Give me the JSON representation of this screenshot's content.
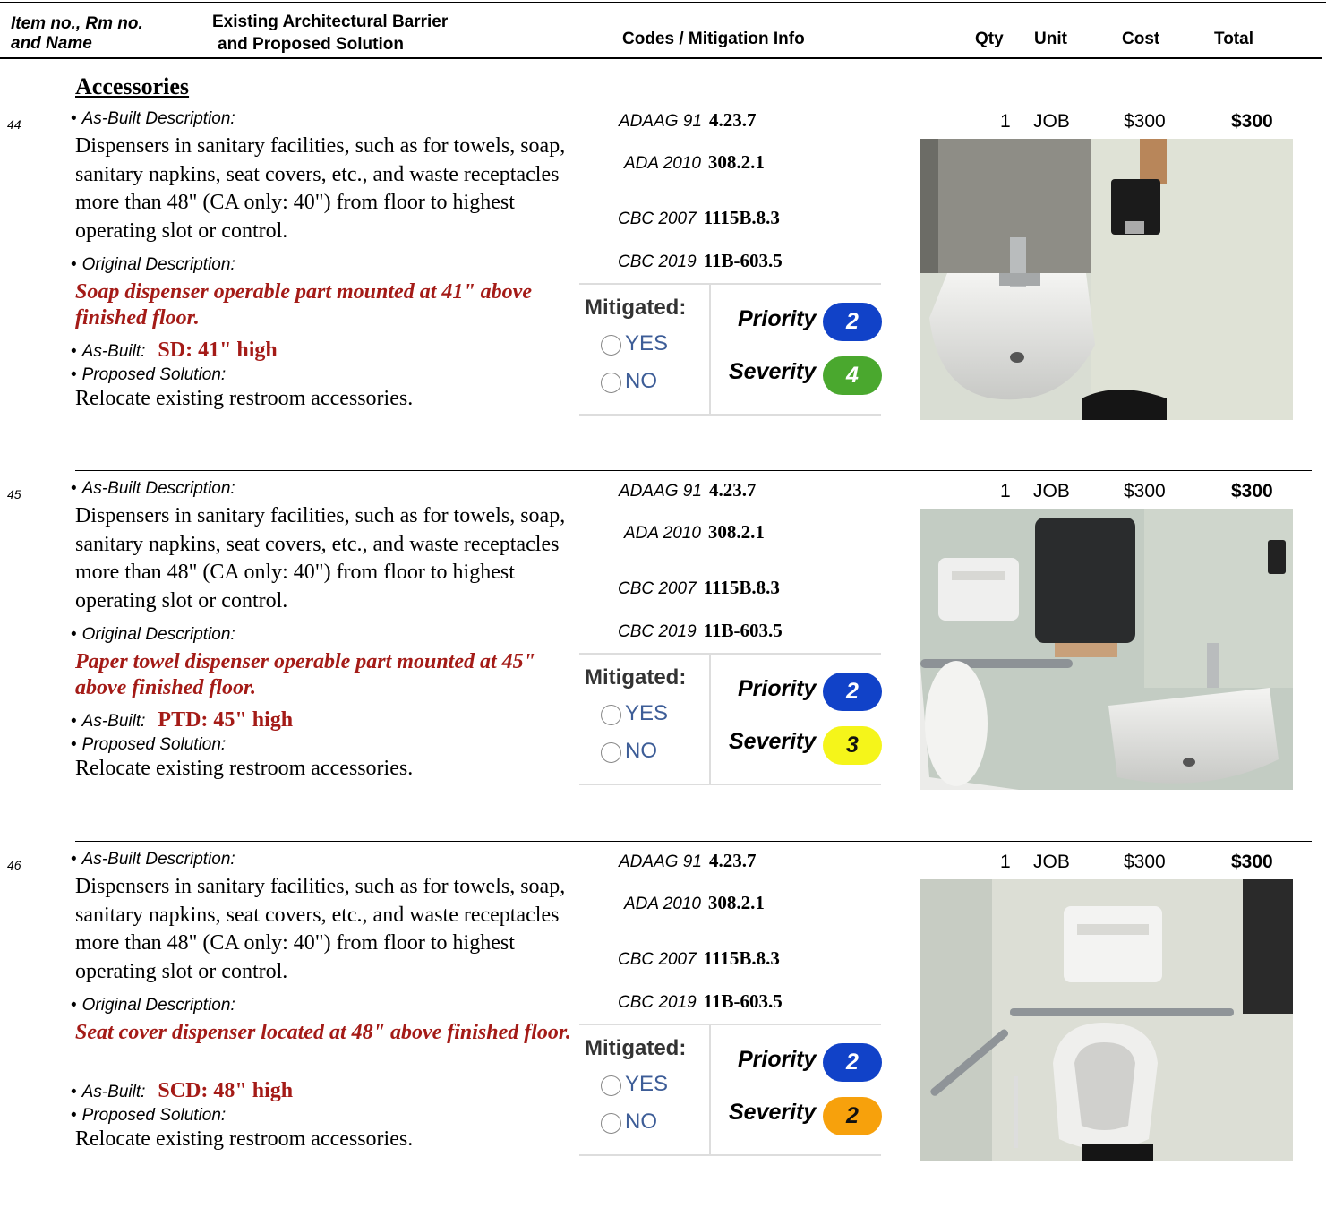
{
  "header": {
    "col_item": "Item no., Rm no. and Name",
    "col_item_line1": "Item no., Rm no.",
    "col_item_line2": "and Name",
    "col_barrier_line1": "Existing Architectural Barrier",
    "col_barrier_line2": "and Proposed Solution",
    "col_codes": "Codes / Mitigation Info",
    "col_qty": "Qty",
    "col_unit": "Unit",
    "col_cost": "Cost",
    "col_total": "Total"
  },
  "section_title": "Accessories",
  "labels": {
    "as_built_description": "As-Built Description:",
    "original_description": "Original Description:",
    "as_built": "As-Built:",
    "proposed_solution": "Proposed Solution:",
    "mitigated": "Mitigated:",
    "yes": "YES",
    "no": "NO",
    "priority": "Priority",
    "severity": "Severity"
  },
  "items": [
    {
      "number": "44",
      "description": "Dispensers in sanitary facilities, such as for towels, soap, sanitary napkins, seat covers, etc., and waste receptacles more than 48\" (CA only: 40\") from floor to highest operating slot or control.",
      "original": "Soap dispenser operable part mounted at 41\" above finished floor.",
      "as_built": "SD: 41\" high",
      "solution": "Relocate existing restroom accessories.",
      "codes": [
        {
          "label": "ADAAG 91",
          "value": "4.23.7"
        },
        {
          "label": "ADA 2010",
          "value": "308.2.1"
        },
        {
          "label": "CBC 2007",
          "value": "1115B.8.3"
        },
        {
          "label": "CBC 2019",
          "value": "11B-603.5"
        }
      ],
      "priority": "2",
      "severity": "4",
      "severity_color": "#4aa82e",
      "severity_text_color": "#ffffff",
      "qty": "1",
      "unit": "JOB",
      "cost": "$300",
      "total": "$300",
      "photo": "sink-and-soap-dispenser"
    },
    {
      "number": "45",
      "description": "Dispensers in sanitary facilities, such as for towels, soap, sanitary napkins, seat covers, etc., and waste receptacles more than 48\" (CA only: 40\") from floor to highest operating slot or control.",
      "original": "Paper towel dispenser operable part mounted at 45\" above finished floor.",
      "as_built": "PTD: 45\" high",
      "solution": "Relocate existing restroom accessories.",
      "codes": [
        {
          "label": "ADAAG 91",
          "value": "4.23.7"
        },
        {
          "label": "ADA 2010",
          "value": "308.2.1"
        },
        {
          "label": "CBC 2007",
          "value": "1115B.8.3"
        },
        {
          "label": "CBC 2019",
          "value": "11B-603.5"
        }
      ],
      "priority": "2",
      "severity": "3",
      "severity_color": "#f5f51a",
      "severity_text_color": "#111111",
      "qty": "1",
      "unit": "JOB",
      "cost": "$300",
      "total": "$300",
      "photo": "paper-towel-dispenser-and-sink"
    },
    {
      "number": "46",
      "description": "Dispensers in sanitary facilities, such as for towels, soap, sanitary napkins, seat covers, etc., and waste receptacles more than 48\" (CA only: 40\") from floor to highest operating slot or control.",
      "original": "Seat cover dispenser located at 48\" above finished floor.",
      "as_built": "SCD: 48\" high",
      "solution": "Relocate existing restroom accessories.",
      "codes": [
        {
          "label": "ADAAG 91",
          "value": "4.23.7"
        },
        {
          "label": "ADA 2010",
          "value": "308.2.1"
        },
        {
          "label": "CBC 2007",
          "value": "1115B.8.3"
        },
        {
          "label": "CBC 2019",
          "value": "11B-603.5"
        }
      ],
      "priority": "2",
      "severity": "2",
      "severity_color": "#f7a10c",
      "severity_text_color": "#111111",
      "qty": "1",
      "unit": "JOB",
      "cost": "$300",
      "total": "$300",
      "photo": "seat-cover-dispenser-and-toilet"
    }
  ],
  "colors": {
    "accent_red": "#a41b17",
    "priority_blue": "#1142c8",
    "radio_blue": "#3d5d97"
  }
}
